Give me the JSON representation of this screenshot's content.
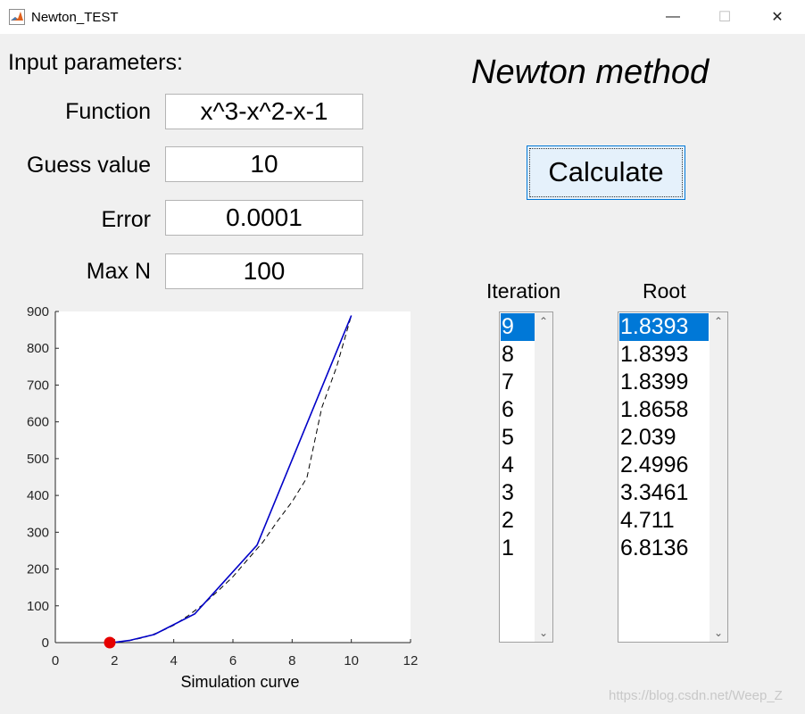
{
  "window": {
    "title": "Newton_TEST",
    "minimize_glyph": "—",
    "maximize_glyph": "☐",
    "close_glyph": "✕"
  },
  "inputs": {
    "header": "Input parameters:",
    "function_label": "Function",
    "function_value": "x^3-x^2-x-1",
    "guess_label": "Guess value",
    "guess_value": "10",
    "error_label": "Error",
    "error_value": "0.0001",
    "maxn_label": "Max N",
    "maxn_value": "100"
  },
  "heading": "Newton method",
  "calculate_label": "Calculate",
  "iteration_header": "Iteration",
  "root_header": "Root",
  "iterations": [
    "9",
    "8",
    "7",
    "6",
    "5",
    "4",
    "3",
    "2",
    "1"
  ],
  "roots": [
    "1.8393",
    "1.8393",
    "1.8399",
    "1.8658",
    "2.039",
    "2.4996",
    "3.3461",
    "4.711",
    "6.8136"
  ],
  "selected_index": 0,
  "scroll_up_glyph": "⌃",
  "scroll_down_glyph": "⌄",
  "watermark": "https://blog.csdn.net/Weep_Z",
  "colors": {
    "selection": "#0078d7",
    "iteration_line": "#0000c8",
    "curve": "#000000",
    "root_marker": "#e60000"
  },
  "chart_data": {
    "type": "line",
    "xlabel": "Simulation curve",
    "ylabel": "",
    "xlim": [
      0,
      12
    ],
    "ylim": [
      0,
      900
    ],
    "xticks": [
      0,
      2,
      4,
      6,
      8,
      10,
      12
    ],
    "yticks": [
      0,
      100,
      200,
      300,
      400,
      500,
      600,
      700,
      800,
      900
    ],
    "grid": false,
    "series": [
      {
        "style": "dashed",
        "x": [
          1.8393,
          2.5,
          3,
          3.5,
          4,
          4.5,
          5,
          5.5,
          6,
          6.5,
          7,
          7.5,
          8,
          8.5,
          9,
          9.5,
          10
        ],
        "y": [
          0,
          5.1,
          14,
          28.1,
          47,
          74.1,
          104,
          140.6,
          179,
          226.1,
          272,
          329.6,
          383,
          448.1,
          638,
          748.9,
          889
        ]
      },
      {
        "style": "solid",
        "x": [
          10,
          6.8136,
          4.711,
          3.3461,
          2.4996,
          2.039,
          1.8658,
          1.8399,
          1.8393
        ],
        "y": [
          889,
          265.0,
          77.8,
          22.1,
          5.8,
          1.0,
          0.09,
          0.0,
          0
        ]
      }
    ],
    "root_point": {
      "x": 1.8393,
      "y": 0
    }
  }
}
